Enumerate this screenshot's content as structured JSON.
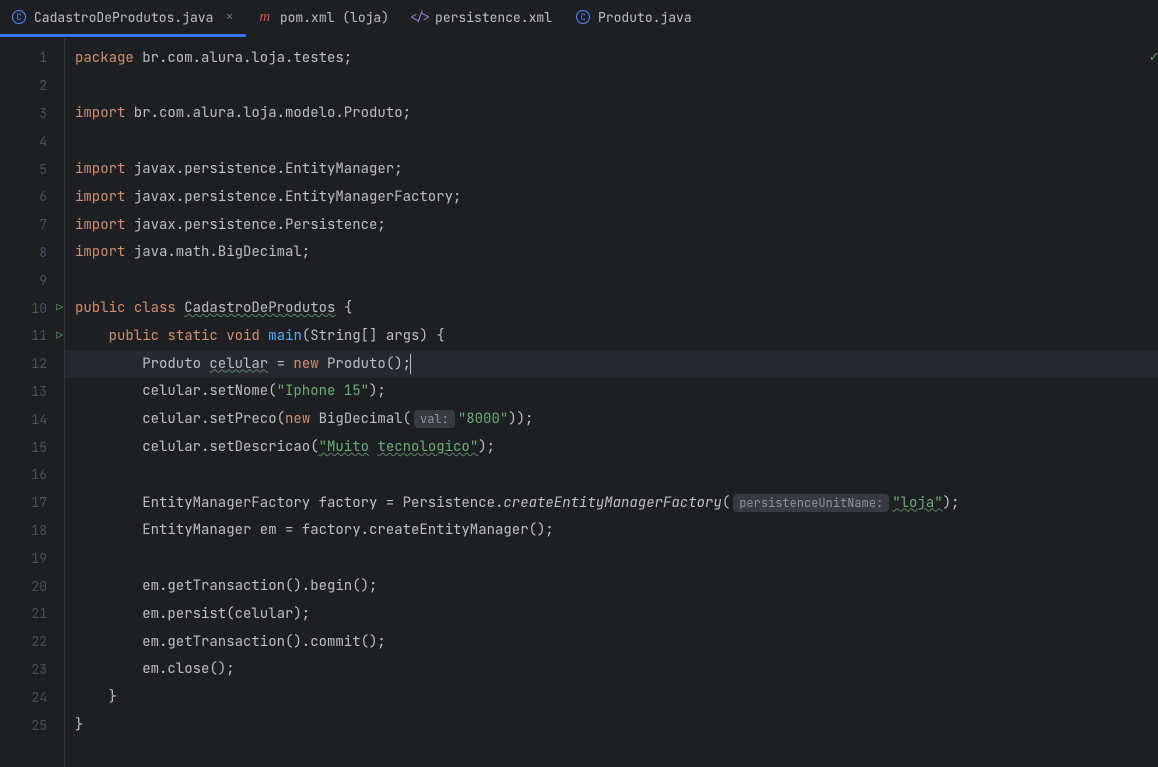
{
  "tabs": [
    {
      "label": "CadastroDeProdutos.java",
      "active": true,
      "hasClose": true
    },
    {
      "label": "pom.xml (loja)",
      "active": false,
      "hasClose": false
    },
    {
      "label": "persistence.xml",
      "active": false,
      "hasClose": false
    },
    {
      "label": "Produto.java",
      "active": false,
      "hasClose": false
    }
  ],
  "lineCount": 25,
  "runLines": [
    10,
    11
  ],
  "highlightedLine": 12,
  "code": {
    "l1": {
      "package": "package",
      "pkg": " br.com.alura.loja.testes;"
    },
    "l3": {
      "import": "import",
      "path": " br.com.alura.loja.modelo.Produto;"
    },
    "l5": {
      "import": "import",
      "path": " javax.persistence.EntityManager;"
    },
    "l6": {
      "import": "import",
      "path": " javax.persistence.EntityManagerFactory;"
    },
    "l7": {
      "import": "import",
      "path": " javax.persistence.Persistence;"
    },
    "l8": {
      "import": "import",
      "path": " java.math.BigDecimal;"
    },
    "l10": {
      "pub": "public",
      "cls": "class",
      "name": "CadastroDeProdutos",
      "brace": " {"
    },
    "l11": {
      "indent": "    ",
      "pub": "public",
      "stat": "static",
      "void": "void",
      "main": "main",
      "rest": "(String[] args) {"
    },
    "l12": {
      "indent": "        ",
      "type": "Produto ",
      "var": "celular",
      "eq": " = ",
      "new": "new",
      "rest": " Produto();"
    },
    "l13": {
      "indent": "        ",
      "pre": "celular.setNome(",
      "str": "\"Iphone 15\"",
      "post": ");"
    },
    "l14": {
      "indent": "        ",
      "pre": "celular.setPreco(",
      "new": "new",
      "mid": " BigDecimal(",
      "hint": "val:",
      "str": "\"8000\"",
      "post": "));"
    },
    "l15": {
      "indent": "        ",
      "pre": "celular.setDescricao(",
      "str1": "\"Muito",
      "sp": " ",
      "str2": "tecnologico\"",
      "post": ");"
    },
    "l17": {
      "indent": "        ",
      "pre": "EntityManagerFactory factory = Persistence.",
      "ital": "createEntityManagerFactory",
      "paren": "(",
      "hint": "persistenceUnitName:",
      "str": "\"loja\"",
      "post": ");"
    },
    "l18": {
      "indent": "        ",
      "text": "EntityManager em = factory.createEntityManager();"
    },
    "l20": {
      "indent": "        ",
      "text": "em.getTransaction().begin();"
    },
    "l21": {
      "indent": "        ",
      "text": "em.persist(celular);"
    },
    "l22": {
      "indent": "        ",
      "text": "em.getTransaction().commit();"
    },
    "l23": {
      "indent": "        ",
      "text": "em.close();"
    },
    "l24": {
      "indent": "    ",
      "text": "}"
    },
    "l25": {
      "indent": "",
      "text": "}"
    }
  }
}
